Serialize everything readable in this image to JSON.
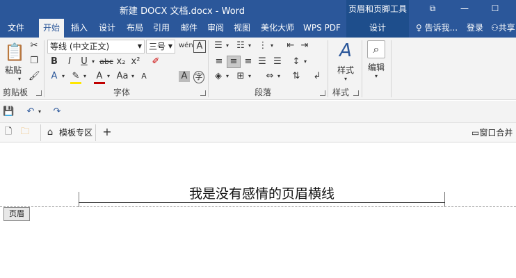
{
  "titlebar": {
    "doc_title": "新建 DOCX 文档.docx - Word",
    "context_title": "页眉和页脚工具",
    "window_controls": [
      "restore-ribbon-icon",
      "minimize-icon",
      "maximize-icon"
    ],
    "accent": "#2b579a"
  },
  "tabs": {
    "items": [
      "文件",
      "开始",
      "插入",
      "设计",
      "布局",
      "引用",
      "邮件",
      "审阅",
      "视图",
      "美化大师",
      "WPS PDF",
      "设计"
    ],
    "active": "开始",
    "tell_me": "告诉我...",
    "login": "登录",
    "share": "共享"
  },
  "ribbon": {
    "clipboard": {
      "paste": "粘贴",
      "label": "剪贴板"
    },
    "font": {
      "font_name": "等线 (中文正文)",
      "font_size": "三号",
      "bold": "B",
      "italic": "I",
      "underline": "U",
      "strike": "abc",
      "subscript": "x₂",
      "superscript": "x²",
      "font_color": "A",
      "change_case": "Aa",
      "label": "字体"
    },
    "paragraph": {
      "label": "段落"
    },
    "styles": {
      "button": "样式",
      "label": "样式"
    },
    "editing": {
      "button": "编辑"
    }
  },
  "doc_tabs": {
    "template_zone": "模板专区",
    "add": "+",
    "window_merge": "窗口合并"
  },
  "document": {
    "header_text": "我是没有感情的页眉横线",
    "header_tag": "页眉"
  }
}
